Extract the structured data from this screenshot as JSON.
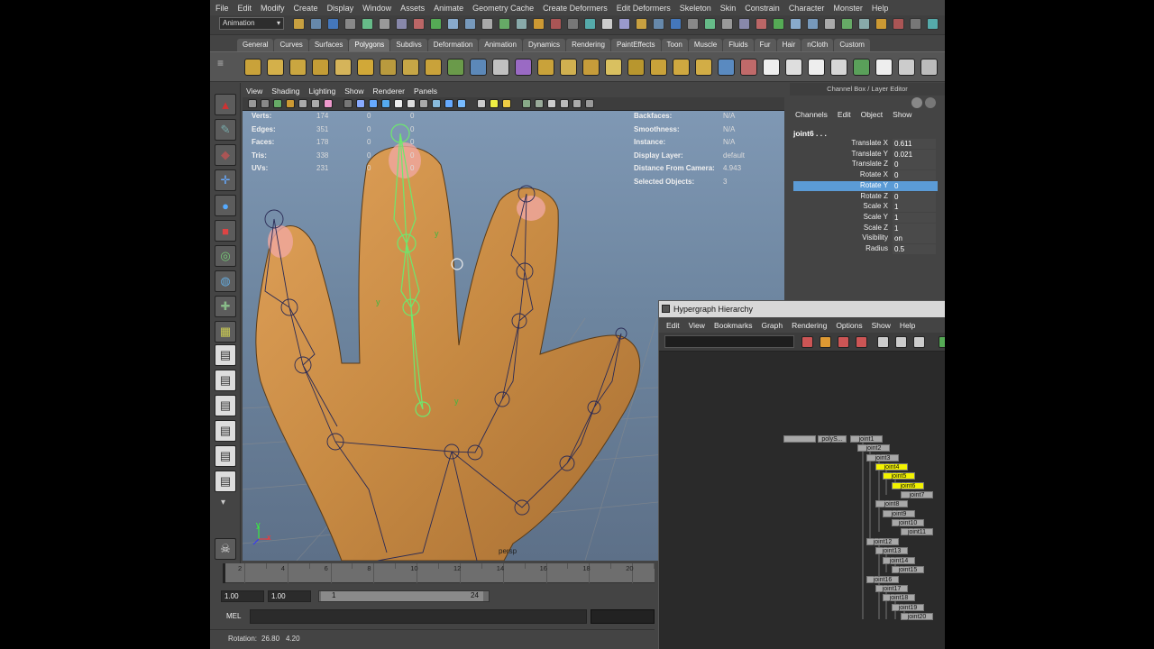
{
  "menubar": [
    "File",
    "Edit",
    "Modify",
    "Create",
    "Display",
    "Window",
    "Assets",
    "Animate",
    "Geometry Cache",
    "Create Deformers",
    "Edit Deformers",
    "Skeleton",
    "Skin",
    "Constrain",
    "Character",
    "Monster",
    "Help"
  ],
  "mode_selector": "Animation",
  "shelf_tabs": [
    "General",
    "Curves",
    "Surfaces",
    "Polygons",
    "Subdivs",
    "Deformation",
    "Animation",
    "Dynamics",
    "Rendering",
    "PaintEffects",
    "Toon",
    "Muscle",
    "Fluids",
    "Fur",
    "Hair",
    "nCloth",
    "Custom"
  ],
  "active_shelf_tab": "Polygons",
  "viewport": {
    "menu": [
      "View",
      "Shading",
      "Lighting",
      "Show",
      "Renderer",
      "Panels"
    ],
    "hud_left": [
      {
        "label": "Verts:",
        "v1": "174",
        "v2": "0",
        "v3": "0"
      },
      {
        "label": "Edges:",
        "v1": "351",
        "v2": "0",
        "v3": "0"
      },
      {
        "label": "Faces:",
        "v1": "178",
        "v2": "0",
        "v3": "0"
      },
      {
        "label": "Tris:",
        "v1": "338",
        "v2": "0",
        "v3": "0"
      },
      {
        "label": "UVs:",
        "v1": "231",
        "v2": "0",
        "v3": "0"
      }
    ],
    "hud_right": [
      {
        "label": "Backfaces:",
        "value": "N/A"
      },
      {
        "label": "Smoothness:",
        "value": "N/A"
      },
      {
        "label": "Instance:",
        "value": "N/A"
      },
      {
        "label": "Display Layer:",
        "value": "default"
      },
      {
        "label": "Distance From Camera:",
        "value": "4.943"
      },
      {
        "label": "Selected Objects:",
        "value": "3"
      }
    ],
    "camera": "persp",
    "axis_y": "y",
    "axis_x": "x"
  },
  "timeline": {
    "ticks": [
      "2",
      "4",
      "6",
      "8",
      "10",
      "12",
      "14",
      "16",
      "18",
      "20"
    ],
    "start": "1.00",
    "range_start": "1.00",
    "range_min": "1",
    "range_max": "24"
  },
  "mel": {
    "label": "MEL"
  },
  "helpline": {
    "label": "Rotation:",
    "x": "26.80",
    "y": "4.20"
  },
  "channel_box": {
    "title": "Channel Box / Layer Editor",
    "menu": [
      "Channels",
      "Edit",
      "Object",
      "Show"
    ],
    "object": "joint6 . . .",
    "channels": [
      {
        "name": "Translate X",
        "value": "0.611"
      },
      {
        "name": "Translate Y",
        "value": "0.021"
      },
      {
        "name": "Translate Z",
        "value": "0"
      },
      {
        "name": "Rotate X",
        "value": "0"
      },
      {
        "name": "Rotate Y",
        "value": "0"
      },
      {
        "name": "Rotate Z",
        "value": "0"
      },
      {
        "name": "Scale X",
        "value": "1"
      },
      {
        "name": "Scale Y",
        "value": "1"
      },
      {
        "name": "Scale Z",
        "value": "1"
      },
      {
        "name": "Visibility",
        "value": "on"
      },
      {
        "name": "Radius",
        "value": "0.5"
      }
    ],
    "selected_channel": "Rotate Y"
  },
  "hypergraph": {
    "title": "Hypergraph Hierarchy",
    "menu": [
      "Edit",
      "View",
      "Bookmarks",
      "Graph",
      "Rendering",
      "Options",
      "Show",
      "Help"
    ],
    "nodes": [
      {
        "label": "",
        "sel": false
      },
      {
        "label": "polyS...",
        "sel": false
      },
      {
        "label": "joint1",
        "sel": false
      },
      {
        "label": "joint2",
        "sel": false
      },
      {
        "label": "joint3",
        "sel": false
      },
      {
        "label": "joint4",
        "sel": true
      },
      {
        "label": "joint5",
        "sel": true
      },
      {
        "label": "joint6",
        "sel": true
      },
      {
        "label": "joint7",
        "sel": false
      },
      {
        "label": "joint8",
        "sel": false
      },
      {
        "label": "joint9",
        "sel": false
      },
      {
        "label": "joint10",
        "sel": false
      },
      {
        "label": "joint11",
        "sel": false
      },
      {
        "label": "joint12",
        "sel": false
      },
      {
        "label": "joint13",
        "sel": false
      },
      {
        "label": "joint14",
        "sel": false
      },
      {
        "label": "joint15",
        "sel": false
      },
      {
        "label": "joint16",
        "sel": false
      },
      {
        "label": "joint17",
        "sel": false
      },
      {
        "label": "joint18",
        "sel": false
      },
      {
        "label": "joint19",
        "sel": false
      },
      {
        "label": "joint20",
        "sel": false
      }
    ]
  }
}
